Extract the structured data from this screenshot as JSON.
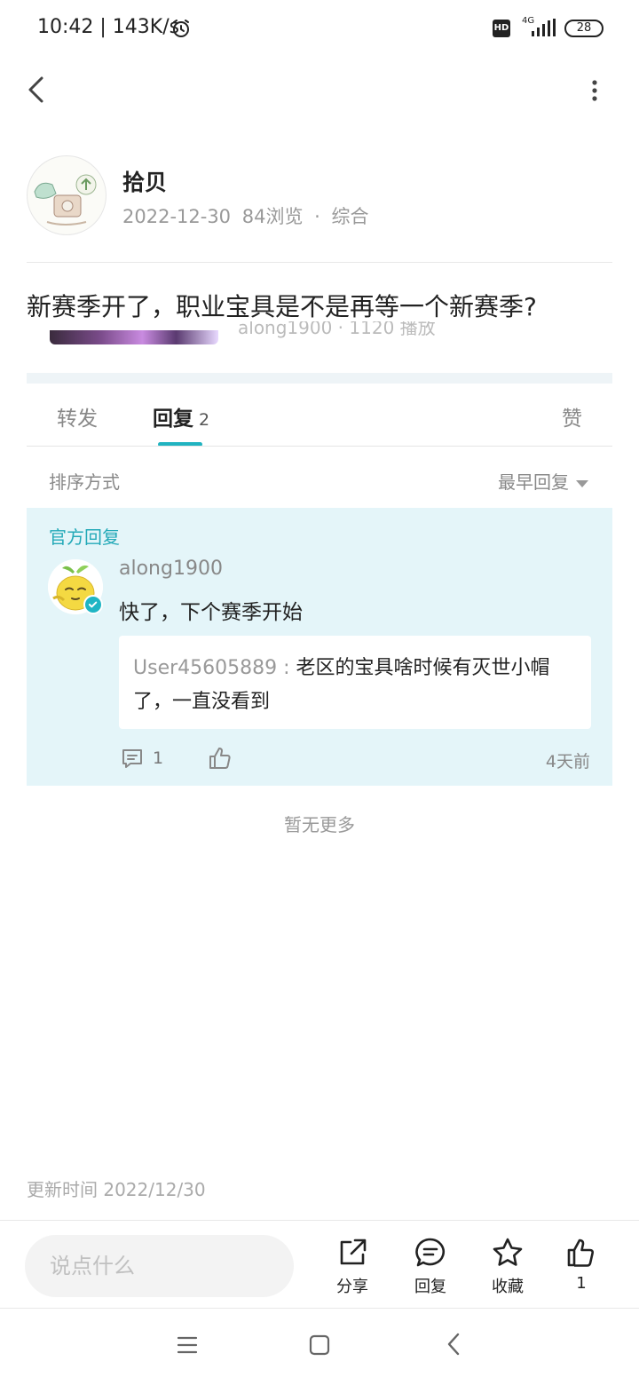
{
  "status_bar": {
    "time_speed": "10:42 | 143K/s",
    "hd": "HD",
    "network": "4G",
    "battery": "28"
  },
  "post": {
    "author": "拾贝",
    "date": "2022-12-30",
    "views": "84浏览",
    "separator": "·",
    "category": "综合",
    "title": "新赛季开了，职业宝具是不是再等一个新赛季?",
    "clip_caption": "along1900  ·  1120 播放"
  },
  "tabs": {
    "forward": "转发",
    "reply": "回复",
    "reply_count": "2",
    "like": "赞"
  },
  "sort": {
    "label": "排序方式",
    "selected": "最早回复"
  },
  "official_reply": {
    "label": "官方回复",
    "user": "along1900",
    "text": "快了，下个赛季开始",
    "quote_user": "User45605889 : ",
    "quote_text": "老区的宝具啥时候有灭世小帽了，一直没看到",
    "comment_count": "1",
    "time": "4天前"
  },
  "no_more": "暂无更多",
  "update_time": "更新时间 2022/12/30",
  "bottom_bar": {
    "input_placeholder": "说点什么",
    "share": "分享",
    "reply": "回复",
    "favorite": "收藏",
    "like_count": "1"
  },
  "colors": {
    "accent": "#20b3c0",
    "official_bg": "#e4f5f9",
    "official_label": "#23a9b8"
  }
}
